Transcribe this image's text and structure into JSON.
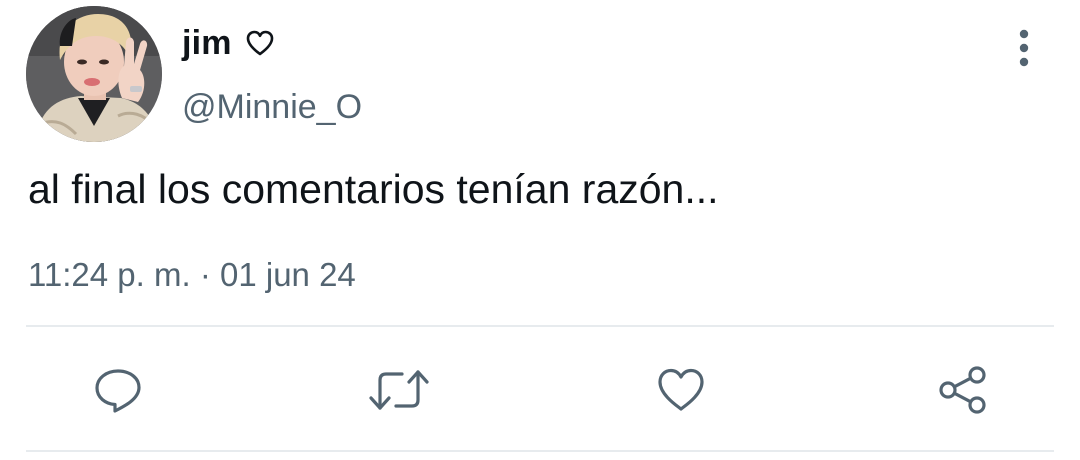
{
  "tweet": {
    "author": {
      "display_name": "jim",
      "handle": "@Minnie_O"
    },
    "text": "al final los comentarios tenían razón...",
    "time": "11:24 p. m.",
    "separator": "·",
    "date": "01 jun 24"
  },
  "icons": {
    "name_badge": "heart-outline-icon",
    "more": "vertical-ellipsis-icon",
    "reply": "speech-bubble-icon",
    "retweet": "retweet-arrows-icon",
    "like": "heart-outline-icon",
    "share": "share-nodes-icon"
  },
  "colors": {
    "text_primary": "#0f1419",
    "text_secondary": "#536471",
    "icon": "#536471",
    "divider": "#e7ebee",
    "background": "#ffffff"
  }
}
